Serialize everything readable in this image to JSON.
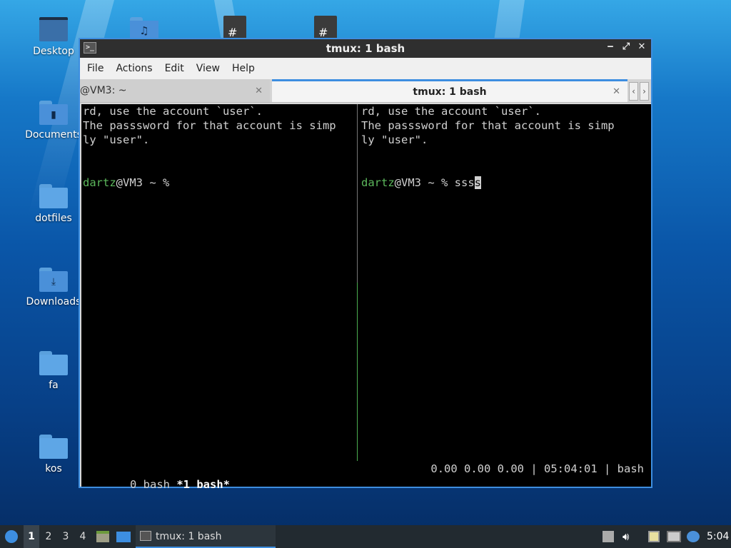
{
  "desktop": {
    "icons": [
      {
        "label": "Desktop",
        "type": "folder-dark"
      },
      {
        "label": "Documents",
        "type": "folder-doc"
      },
      {
        "label": "dotfiles",
        "type": "folder"
      },
      {
        "label": "Downloads",
        "type": "folder-download"
      },
      {
        "label": "fa",
        "type": "folder"
      },
      {
        "label": "kos",
        "type": "folder"
      }
    ]
  },
  "window": {
    "title": "tmux: 1 bash",
    "controls": {
      "minimize": "‒",
      "maximize": "⤢",
      "close": "✕"
    },
    "menu": [
      "File",
      "Actions",
      "Edit",
      "View",
      "Help"
    ],
    "tabs": [
      {
        "label": "@VM3: ~",
        "active": false
      },
      {
        "label": "tmux: 1 bash",
        "active": true
      }
    ],
    "tab_close": "✕",
    "tab_scroll_left": "‹",
    "tab_scroll_right": "›"
  },
  "terminal": {
    "left_pane": {
      "lines": [
        "rd, use the account `user`.",
        "The passsword for that account is simp",
        "ly \"user\"."
      ],
      "prompt_user": "dartz",
      "prompt_rest": "@VM3 ~ %",
      "command": ""
    },
    "right_pane": {
      "lines": [
        "rd, use the account `user`.",
        "The passsword for that account is simp",
        "ly \"user\"."
      ],
      "prompt_user": "dartz",
      "prompt_rest": "@VM3 ~ % ",
      "command": "sss",
      "cursor_char": "s"
    },
    "status_bar": {
      "window0": "0 bash ",
      "window1": "*1 bash*",
      "load": "0.00 0.00 0.00",
      "sep": " | ",
      "time": "05:04:01",
      "session": "bash"
    }
  },
  "taskbar": {
    "workspaces": [
      "1",
      "2",
      "3",
      "4"
    ],
    "active_workspace": "1",
    "task_label": "tmux: 1 bash",
    "clock": "5:04",
    "tray_icons": [
      "upload-icon",
      "volume-icon",
      "clipboard-icon",
      "network-icon",
      "update-icon"
    ]
  },
  "colors": {
    "accent": "#3d8ee0",
    "prompt_user": "#5cb85c",
    "terminal_bg": "#000000"
  }
}
